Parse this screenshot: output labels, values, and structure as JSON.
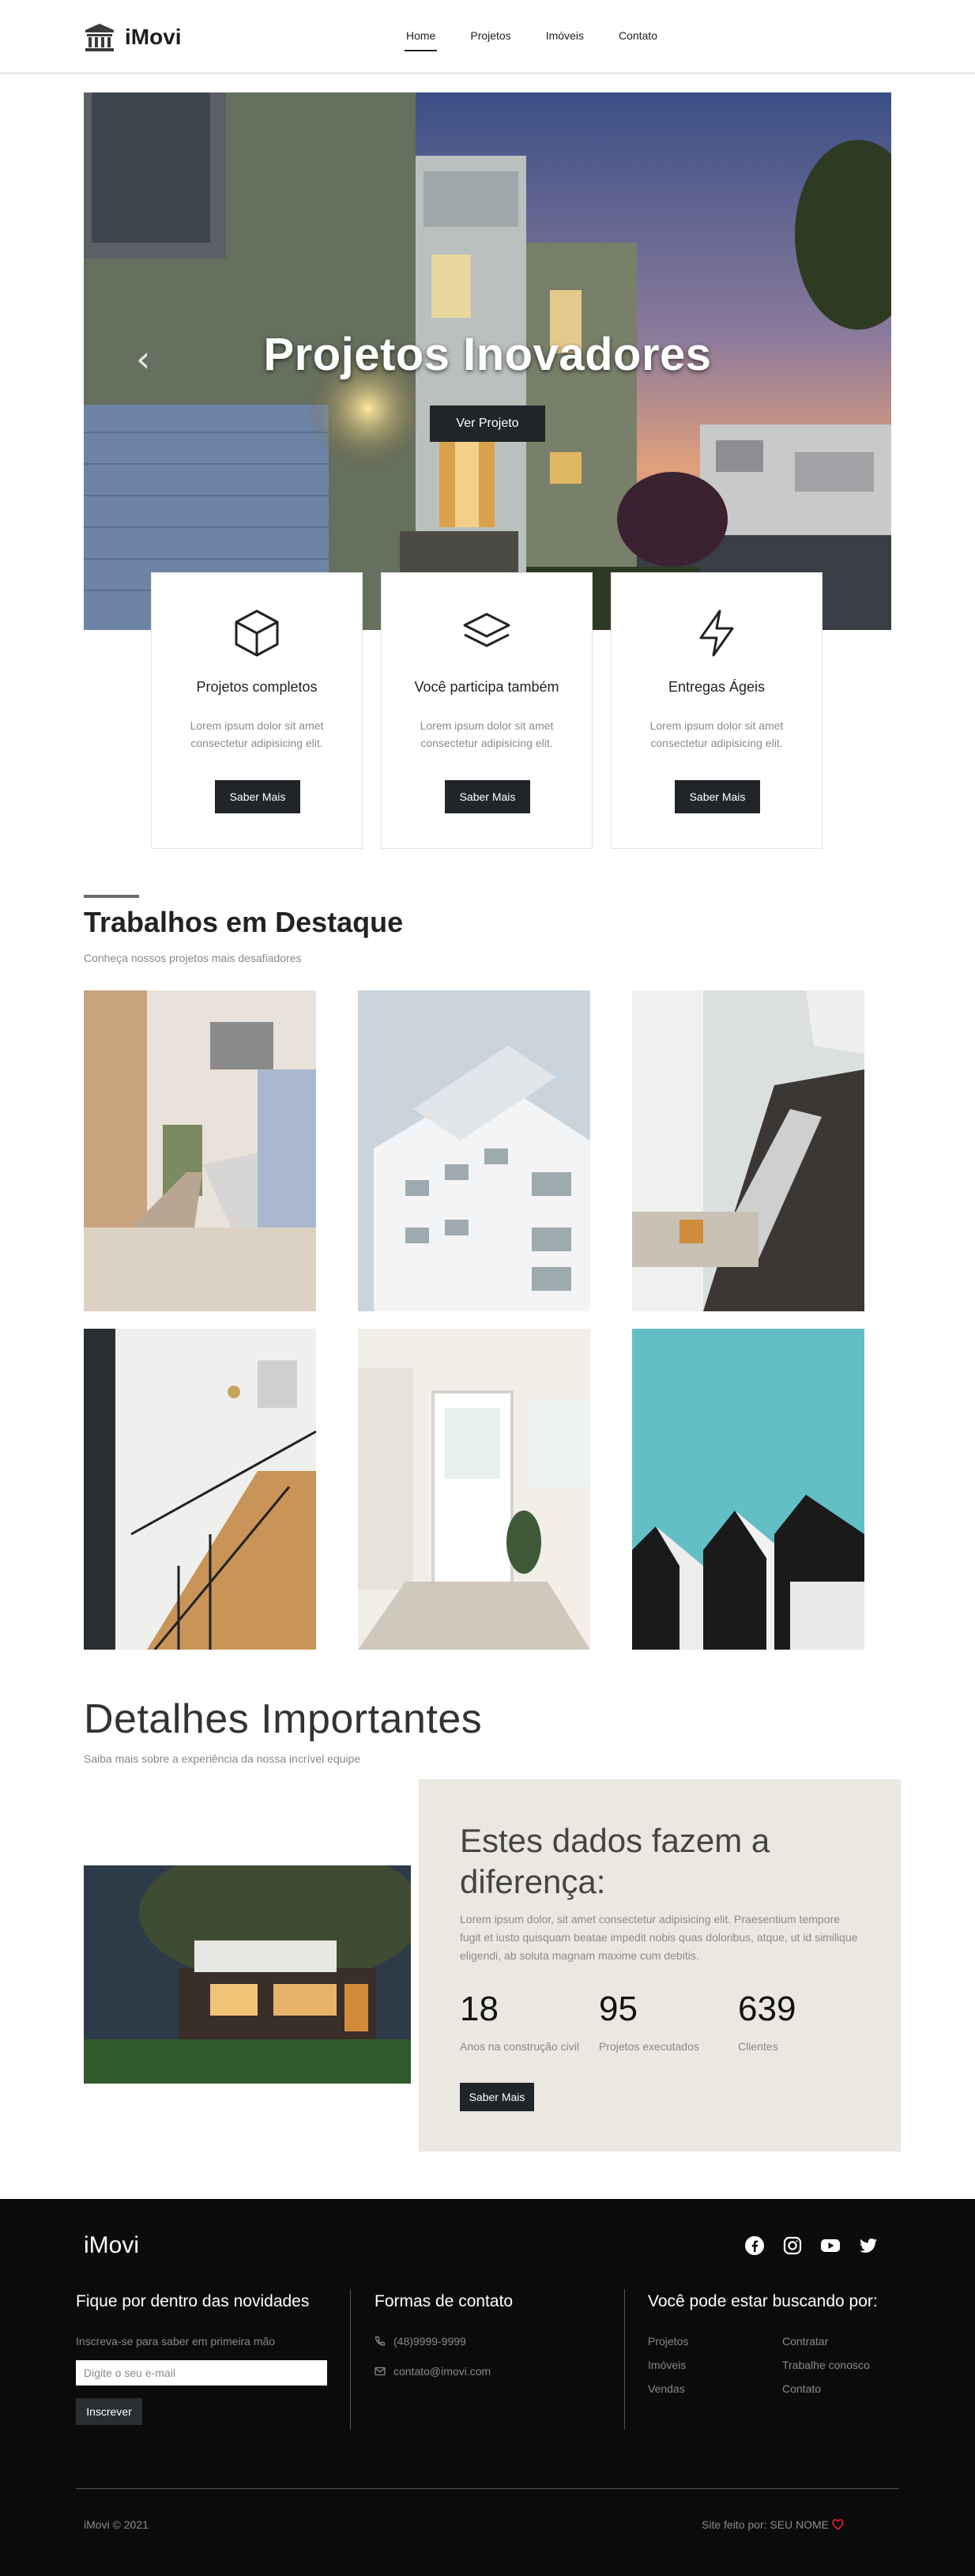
{
  "brand": {
    "name": "iMovi"
  },
  "nav": {
    "items": [
      {
        "label": "Home"
      },
      {
        "label": "Projetos"
      },
      {
        "label": "Imóveis"
      },
      {
        "label": "Contato"
      }
    ]
  },
  "hero": {
    "title": "Projetos Inovadores",
    "button": "Ver Projeto",
    "prev_glyph": "‹"
  },
  "features": [
    {
      "icon": "box-icon",
      "title": "Projetos completos",
      "text": "Lorem ipsum dolor sit amet consectetur adipisicing elit.",
      "button": "Saber Mais"
    },
    {
      "icon": "layers-icon",
      "title": "Você participa também",
      "text": "Lorem ipsum dolor sit amet consectetur adipisicing elit.",
      "button": "Saber Mais"
    },
    {
      "icon": "lightning-icon",
      "title": "Entregas Ágeis",
      "text": "Lorem ipsum dolor sit amet consectetur adipisicing elit.",
      "button": "Saber Mais"
    }
  ],
  "featured": {
    "title": "Trabalhos em Destaque",
    "subtitle": "Conheça nossos projetos mais desafiadores"
  },
  "details": {
    "title": "Detalhes Importantes",
    "subtitle": "Saiba mais sobre a experiência da nossa incrível equipe",
    "card_title": "Estes dados fazem a diferença:",
    "card_text": "Lorem ipsum dolor, sit amet consectetur adipisicing elit. Praesentium tempore fugit et iusto quisquam beatae impedit nobis quas doloribus, atque, ut id similique eligendi, ab soluta magnam maxime cum debitis.",
    "stats": [
      {
        "number": "18",
        "label": "Anos na construção civil"
      },
      {
        "number": "95",
        "label": "Projetos executados"
      },
      {
        "number": "639",
        "label": "Clientes"
      }
    ],
    "button": "Saber Mais"
  },
  "footer": {
    "logo": "iMovi",
    "socials": [
      "facebook-icon",
      "instagram-icon",
      "youtube-icon",
      "twitter-icon"
    ],
    "newsletter": {
      "title": "Fique por dentro das novidades",
      "text": "Inscreva-se para saber em primeira mão",
      "placeholder": "Digite o seu e-mail",
      "button": "Inscrever"
    },
    "contact": {
      "title": "Formas de contato",
      "phone": "(48)9999-9999",
      "email": "contato@imovi.com"
    },
    "links": {
      "title": "Você pode estar buscando por:",
      "items": [
        "Projetos",
        "Contratar",
        "Imóveis",
        "Trabalhe conosco",
        "Vendas",
        "Contato"
      ]
    },
    "copyright": "iMovi © 2021",
    "credit": "Site feito por: SEU NOME"
  },
  "colors": {
    "dark": "#212529",
    "footer_bg": "#0b0b0c",
    "card_bg": "#ebe7e1",
    "heart": "#e01e2a"
  }
}
